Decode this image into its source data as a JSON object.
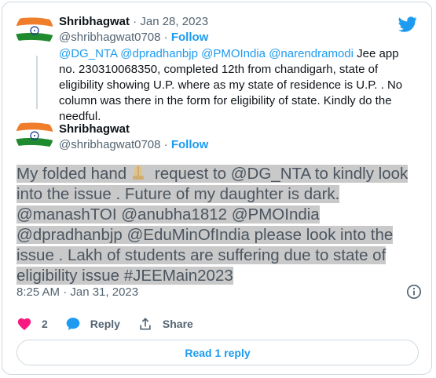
{
  "reply_tweet": {
    "author_name": "Shribhagwat",
    "separator": " · ",
    "date": "Jan 28, 2023",
    "handle": "@shribhagwat0708",
    "dot": " · ",
    "follow_label": "Follow",
    "mentions": "@DG_NTA @dpradhanbjp @PMOIndia @narendramodi",
    "text": " Jee app no. 230310068350, completed 12th from chandigarh,  state of eligibility showing U.P. where as my state of residence is U.P. . No column was there in the form for eligibility of state. Kindly do the needful."
  },
  "main_tweet": {
    "author_name": "Shribhagwat",
    "handle": "@shribhagwat0708",
    "dot": " · ",
    "follow_label": "Follow",
    "text_part1": "My folded hand",
    "text_part2": " request to @DG_NTA to kindly look into the issue . Future of my daughter is dark. @manashTOI @anubha1812 @PMOIndia @dpradhanbjp @EduMinOfIndia please look into the issue . Lakh of students  are suffering  due to state of eligibility issue #JEEMain2023",
    "timestamp": "8:25 AM · Jan 31, 2023",
    "like_count": "2",
    "reply_label": "Reply",
    "share_label": "Share",
    "read_reply_label": "Read 1 reply"
  },
  "icons": {
    "brand": "twitter-bird-icon",
    "info": "info-icon",
    "like": "heart-icon",
    "reply": "speech-bubble-icon",
    "share": "share-upload-icon",
    "emoji": "folded-hands-emoji"
  },
  "colors": {
    "accent": "#1d9bf0",
    "like": "#f91880",
    "text": "#0f1419",
    "muted": "#536471",
    "border": "#cfd9de",
    "highlight": "#c9c9c9"
  }
}
